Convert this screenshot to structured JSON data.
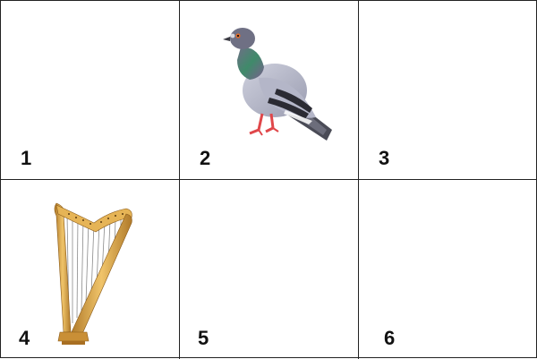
{
  "grid": {
    "cells": [
      {
        "number": "1",
        "content": "empty"
      },
      {
        "number": "2",
        "content": "pigeon-icon"
      },
      {
        "number": "3",
        "content": "empty"
      },
      {
        "number": "4",
        "content": "harp-icon"
      },
      {
        "number": "5",
        "content": "empty"
      },
      {
        "number": "6",
        "content": "empty"
      }
    ]
  }
}
